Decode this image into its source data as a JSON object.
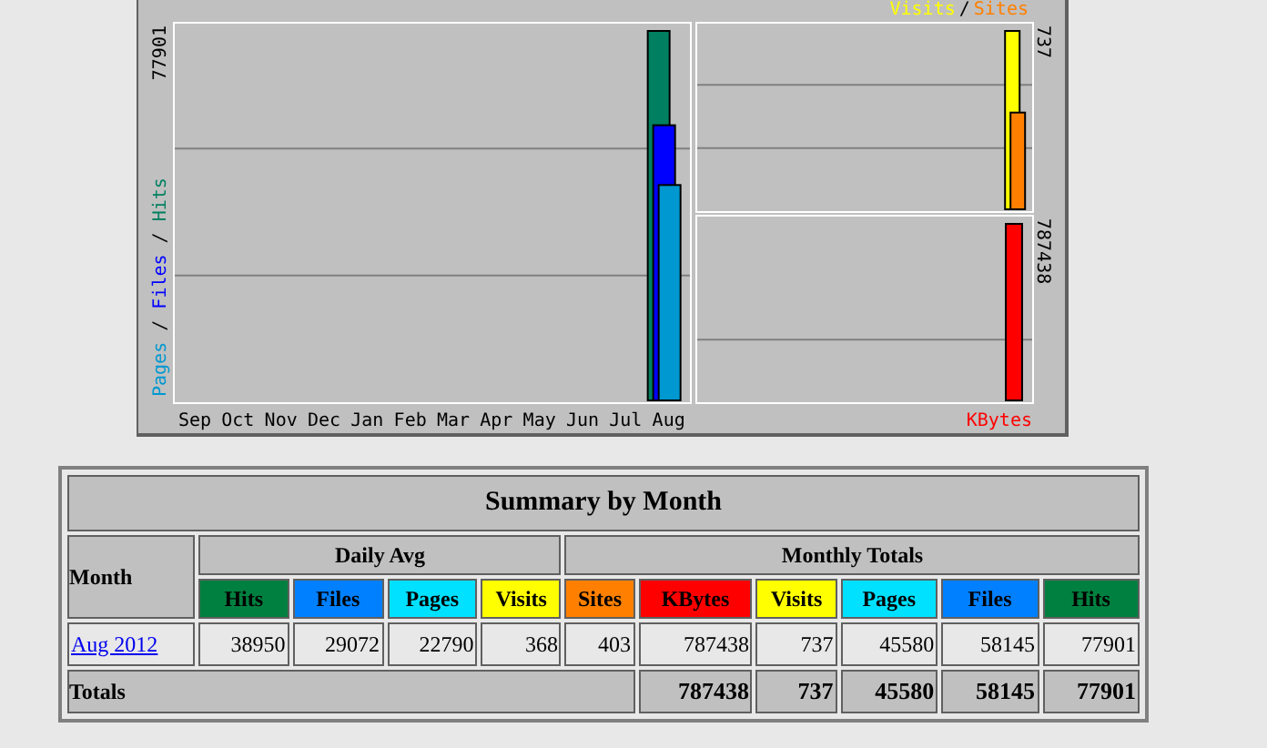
{
  "graph": {
    "legend": {
      "items": [
        {
          "label": "Visits",
          "color": "#ffff00"
        },
        {
          "label": "Sites",
          "color": "#ff8000"
        }
      ],
      "separator": "/"
    },
    "main_chart": {
      "separator": "/",
      "max_label": "77901",
      "legend": [
        {
          "label": "Pages",
          "color": "#0098d0"
        },
        {
          "label": "Files",
          "color": "#0000ff"
        },
        {
          "label": "Hits",
          "color": "#008060"
        }
      ],
      "months": [
        "Sep",
        "Oct",
        "Nov",
        "Dec",
        "Jan",
        "Feb",
        "Mar",
        "Apr",
        "May",
        "Jun",
        "Jul",
        "Aug"
      ]
    },
    "visits_chart": {
      "max_label": "737"
    },
    "kbytes_chart": {
      "max_label": "787438",
      "label": "KBytes",
      "color": "#ff0000"
    }
  },
  "summary": {
    "title": "Summary by Month",
    "month_header": "Month",
    "groups": [
      {
        "label": "Daily Avg",
        "columns": [
          {
            "label": "Hits",
            "color": "#008040"
          },
          {
            "label": "Files",
            "color": "#0080ff"
          },
          {
            "label": "Pages",
            "color": "#00e0ff"
          },
          {
            "label": "Visits",
            "color": "#ffff00"
          }
        ]
      },
      {
        "label": "Monthly Totals",
        "columns": [
          {
            "label": "Sites",
            "color": "#ff8000"
          },
          {
            "label": "KBytes",
            "color": "#ff0000"
          },
          {
            "label": "Visits",
            "color": "#ffff00"
          },
          {
            "label": "Pages",
            "color": "#00e0ff"
          },
          {
            "label": "Files",
            "color": "#0080ff"
          },
          {
            "label": "Hits",
            "color": "#008040"
          }
        ]
      }
    ],
    "rows": [
      {
        "month": "Aug 2012",
        "cells": [
          "38950",
          "29072",
          "22790",
          "368",
          "403",
          "787438",
          "737",
          "45580",
          "58145",
          "77901"
        ]
      }
    ],
    "totals": {
      "label": "Totals",
      "cells": [
        "787438",
        "737",
        "45580",
        "58145",
        "77901"
      ]
    }
  }
}
